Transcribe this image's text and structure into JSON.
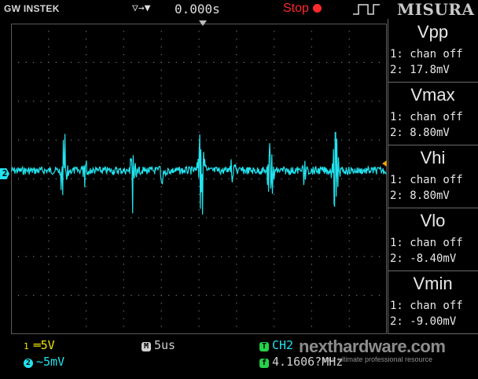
{
  "topbar": {
    "brand": "GW INSTEK",
    "trigger_icons": "▽→▼",
    "trigger_time": "0.000s",
    "run_state": "Stop",
    "misura": "MISURA"
  },
  "marker": {
    "ch2_ground": "2"
  },
  "measurements": [
    {
      "title": "Vpp",
      "ch1": "1: chan off",
      "ch2": "2: 17.8mV"
    },
    {
      "title": "Vmax",
      "ch1": "1: chan off",
      "ch2": "2: 8.80mV"
    },
    {
      "title": "Vhi",
      "ch1": "1: chan off",
      "ch2": "2: 8.80mV"
    },
    {
      "title": "Vlo",
      "ch1": "1: chan off",
      "ch2": "2: -8.40mV"
    },
    {
      "title": "Vmin",
      "ch1": "1: chan off",
      "ch2": "2: -9.00mV"
    }
  ],
  "bottombar": {
    "ch1_badge": "1",
    "ch1_scale": "═5V",
    "ch2_badge": "2",
    "ch2_scale": "~5mV",
    "timebase_badge": "M",
    "timebase": "5us",
    "trigger_badge": "T",
    "trigger_source": "CH2",
    "freq_badge": "f",
    "frequency": "4.1606?MHz"
  },
  "watermark": {
    "main": "nexthardware.com",
    "sub": "your ultimate professional resource"
  },
  "colors": {
    "ch1": "#f2e600",
    "ch2": "#22e3ee",
    "stop": "#ff2a2a",
    "grid": "#7a7a7a"
  }
}
